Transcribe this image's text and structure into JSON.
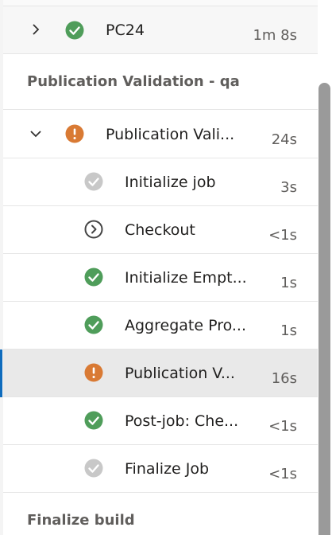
{
  "rows": [
    {
      "label": "PC24",
      "duration": "1m 8s",
      "status": "succeeded"
    },
    {
      "label": "Publication Vali...",
      "duration": "24s",
      "status": "warning"
    },
    {
      "label": "Initialize job",
      "duration": "3s",
      "status": "skipped"
    },
    {
      "label": "Checkout",
      "duration": "<1s",
      "status": "pending"
    },
    {
      "label": "Initialize Empt...",
      "duration": "1s",
      "status": "succeeded"
    },
    {
      "label": "Aggregate Pro...",
      "duration": "1s",
      "status": "succeeded"
    },
    {
      "label": "Publication V...",
      "duration": "16s",
      "status": "warning"
    },
    {
      "label": "Post-job: Che...",
      "duration": "<1s",
      "status": "succeeded"
    },
    {
      "label": "Finalize Job",
      "duration": "<1s",
      "status": "skipped"
    }
  ],
  "sections": {
    "qa": "Publication Validation - qa",
    "finalize": "Finalize build"
  },
  "colors": {
    "success": "#4f9d5a",
    "warning": "#d97a34",
    "skipped": "#c8c8c8",
    "pending": "#444444",
    "selected_bar": "#0f6cbd"
  }
}
